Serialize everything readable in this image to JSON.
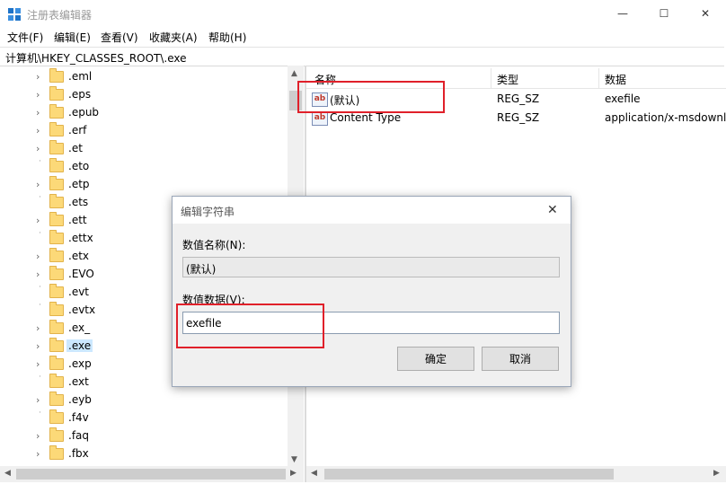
{
  "window": {
    "title": "注册表编辑器",
    "controls": {
      "minimize": "—",
      "maximize": "☐",
      "close": "✕"
    }
  },
  "menu": [
    "文件(F)",
    "编辑(E)",
    "查看(V)",
    "收藏夹(A)",
    "帮助(H)"
  ],
  "address": "计算机\\HKEY_CLASSES_ROOT\\.exe",
  "tree": {
    "items": [
      {
        "label": ".eml",
        "expandable": true
      },
      {
        "label": ".eps",
        "expandable": true
      },
      {
        "label": ".epub",
        "expandable": true
      },
      {
        "label": ".erf",
        "expandable": true
      },
      {
        "label": ".et",
        "expandable": true
      },
      {
        "label": ".eto",
        "expandable": false
      },
      {
        "label": ".etp",
        "expandable": true
      },
      {
        "label": ".ets",
        "expandable": false
      },
      {
        "label": ".ett",
        "expandable": true
      },
      {
        "label": ".ettx",
        "expandable": false
      },
      {
        "label": ".etx",
        "expandable": true
      },
      {
        "label": ".EVO",
        "expandable": true
      },
      {
        "label": ".evt",
        "expandable": false
      },
      {
        "label": ".evtx",
        "expandable": false
      },
      {
        "label": ".ex_",
        "expandable": true
      },
      {
        "label": ".exe",
        "expandable": true,
        "selected": true
      },
      {
        "label": ".exp",
        "expandable": true
      },
      {
        "label": ".ext",
        "expandable": false
      },
      {
        "label": ".eyb",
        "expandable": true
      },
      {
        "label": ".f4v",
        "expandable": false
      },
      {
        "label": ".faq",
        "expandable": true
      },
      {
        "label": ".fbx",
        "expandable": true
      }
    ]
  },
  "list": {
    "columns": [
      "名称",
      "类型",
      "数据"
    ],
    "rows": [
      {
        "name": "(默认)",
        "type": "REG_SZ",
        "data": "exefile",
        "icon": "ab"
      },
      {
        "name": "Content Type",
        "type": "REG_SZ",
        "data": "application/x-msdownl",
        "icon": "ab"
      }
    ]
  },
  "dialog": {
    "title": "编辑字符串",
    "close": "✕",
    "name_label": "数值名称(N):",
    "name_value": "(默认)",
    "data_label": "数值数据(V):",
    "data_value": "exefile",
    "ok": "确定",
    "cancel": "取消"
  },
  "scroll": {
    "up": "▲",
    "down": "▼",
    "left": "◀",
    "right": "▶"
  },
  "highlight_color": "#e0202a"
}
